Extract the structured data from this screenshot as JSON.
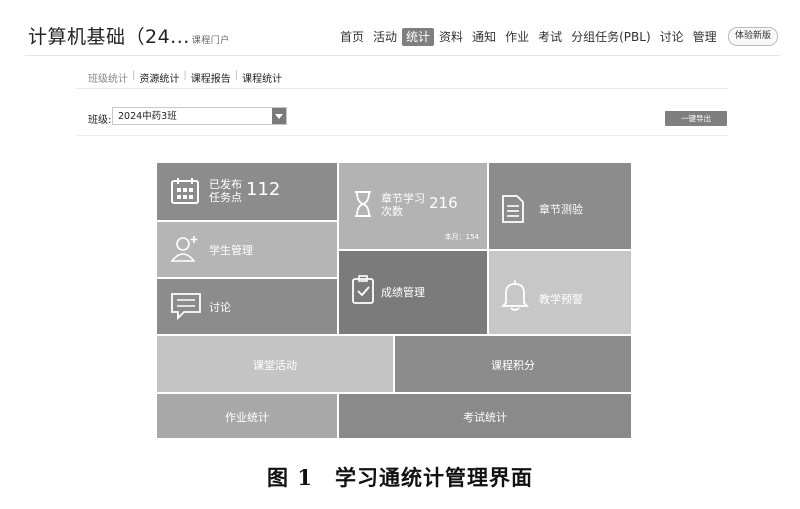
{
  "header": {
    "course_title": "计算机基础（24...",
    "course_sub": "课程门户",
    "nav": [
      "首页",
      "活动",
      "统计",
      "资料",
      "通知",
      "作业",
      "考试",
      "分组任务(PBL)",
      "讨论",
      "管理"
    ],
    "nav_active": "统计",
    "trial_label": "体验新版"
  },
  "subnav": [
    "班级统计",
    "资源统计",
    "课程报告",
    "课程统计"
  ],
  "filter": {
    "class_label": "班级:",
    "class_value": "2024中药3班",
    "export_label": "一键导出"
  },
  "tiles": {
    "published": {
      "label_line1": "已发布",
      "label_line2": "任务点",
      "value": "112"
    },
    "chapter_learning": {
      "label_line1": "章节学习",
      "label_line2": "次数",
      "value": "216",
      "month_text": "本月：154"
    },
    "chapter_test": {
      "label": "章节测验"
    },
    "student_mgmt": {
      "label": "学生管理"
    },
    "grade_mgmt": {
      "label": "成绩管理"
    },
    "discussion": {
      "label": "讨论"
    },
    "warning": {
      "label": "教学预警"
    },
    "class_activity": {
      "label": "课堂活动"
    },
    "course_points": {
      "label": "课程积分"
    },
    "homework_stats": {
      "label": "作业统计"
    },
    "exam_stats": {
      "label": "考试统计"
    }
  },
  "colors": {
    "tile_dark": "#8c8c8c",
    "tile_mid": "#a6a6a6",
    "tile_light": "#c0c0c0",
    "tile_darkest": "#7b7b7b"
  },
  "caption": {
    "number": "图 1",
    "text": "学习通统计管理界面"
  }
}
